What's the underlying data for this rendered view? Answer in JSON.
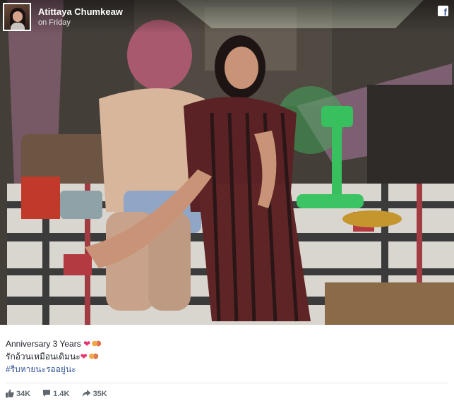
{
  "post": {
    "author": "Atittaya Chumkeaw",
    "time": "on Friday",
    "caption_line1": "Anniversary 3 Years",
    "caption_line2": "รักอ้วนเหมือนเดิมนะ",
    "caption_hashtag": "#รีบหายนะรออยู่นะ"
  },
  "stats": {
    "likes": "34K",
    "comments": "1.4K",
    "shares": "35K"
  },
  "icons": {
    "logo": "facebook-icon",
    "like": "thumbs-up-icon",
    "comment": "comment-icon",
    "share": "share-arrow-icon",
    "heart": "heart-icon"
  },
  "colors": {
    "brand": "#3b5998",
    "hashtag": "#365899",
    "heart": "#e8336f",
    "stat_text": "#606770"
  }
}
